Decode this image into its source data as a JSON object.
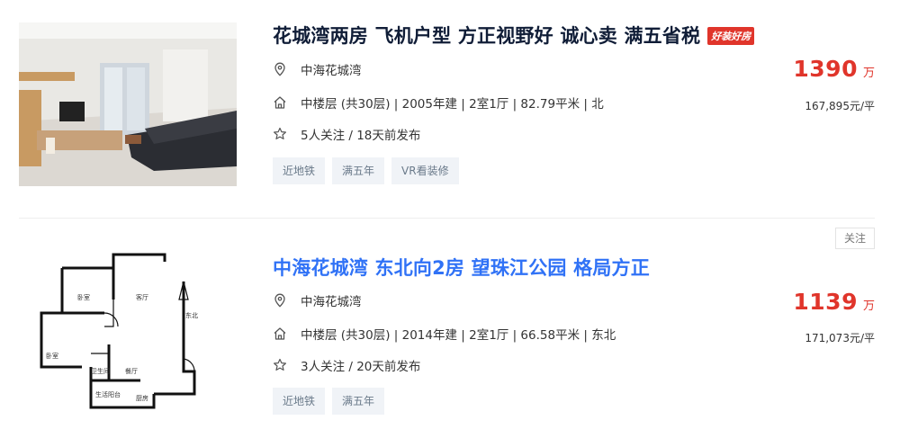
{
  "colors": {
    "price_red": "#e0352b",
    "title_blue": "#3072f6",
    "title_dark": "#101d37",
    "tag_bg": "#f0f3f7"
  },
  "listings": [
    {
      "title": "花城湾两房 飞机户型 方正视野好 诚心卖 满五省税",
      "badge": "好装好房",
      "community": "中海花城湾",
      "info": "中楼层 (共30层) | 2005年建 | 2室1厅 | 82.79平米 | 北",
      "followers": "5人关注 / 18天前发布",
      "tags": [
        "近地铁",
        "满五年",
        "VR看装修"
      ],
      "price": "1390",
      "price_unit": "万",
      "unit_price": "167,895元/平",
      "icons": [
        "location-pin-icon",
        "house-icon",
        "star-icon"
      ]
    },
    {
      "title": "中海花城湾 东北向2房 望珠江公园 格局方正",
      "community": "中海花城湾",
      "info": "中楼层 (共30层) | 2014年建 | 2室1厅 | 66.58平米 | 东北",
      "followers": "3人关注 / 20天前发布",
      "tags": [
        "近地铁",
        "满五年"
      ],
      "price": "1139",
      "price_unit": "万",
      "unit_price": "171,073元/平",
      "follow_label": "关注",
      "icons": [
        "location-pin-icon",
        "house-icon",
        "star-icon"
      ]
    }
  ]
}
